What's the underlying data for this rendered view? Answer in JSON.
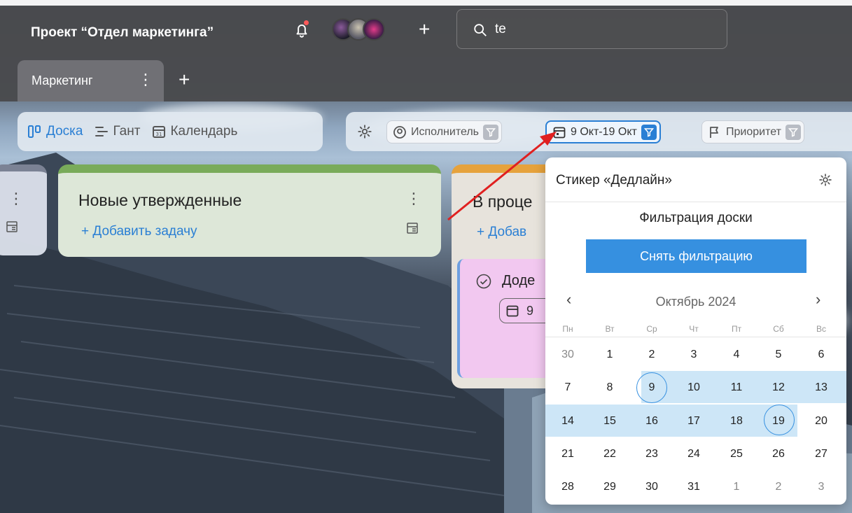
{
  "header": {
    "project_title": "Проект “Отдел маркетинга”",
    "search_value": "te"
  },
  "tabs": {
    "active_label": "Маркетинг"
  },
  "views": [
    {
      "label": "Доска",
      "icon": "board-icon",
      "active": true
    },
    {
      "label": "Гант",
      "icon": "gantt-icon",
      "active": false
    },
    {
      "label": "Календарь",
      "icon": "calendar-icon",
      "active": false
    }
  ],
  "filters": {
    "assignee": "Исполнитель",
    "date_range": "9 Окт-19 Окт",
    "priority": "Приоритет"
  },
  "columns": {
    "new_title": "Новые утвержденные",
    "new_add": "+ Добавить задачу",
    "progress_title": "В проце",
    "progress_add": "+ Добав",
    "card_title": "Доде",
    "card_date": "9"
  },
  "popup": {
    "title": "Стикер «Дедлайн»",
    "subtitle": "Фильтрация доски",
    "clear_button": "Снять фильтрацию",
    "month": "Октябрь 2024",
    "weekdays": [
      "Пн",
      "Вт",
      "Ср",
      "Чт",
      "Пт",
      "Сб",
      "Вс"
    ],
    "weeks": [
      [
        "30",
        "1",
        "2",
        "3",
        "4",
        "5",
        "6"
      ],
      [
        "7",
        "8",
        "9",
        "10",
        "11",
        "12",
        "13"
      ],
      [
        "14",
        "15",
        "16",
        "17",
        "18",
        "19",
        "20"
      ],
      [
        "21",
        "22",
        "23",
        "24",
        "25",
        "26",
        "27"
      ],
      [
        "28",
        "29",
        "30",
        "31",
        "1",
        "2",
        "3"
      ]
    ],
    "range_start": "9",
    "range_end": "19"
  },
  "colors": {
    "accent": "#3690e0",
    "range_highlight": "#cde6f7",
    "column_new": "#79ab5a",
    "column_progress": "#e6a23c",
    "card": "#f2c8f0",
    "arrow": "#e02020"
  }
}
